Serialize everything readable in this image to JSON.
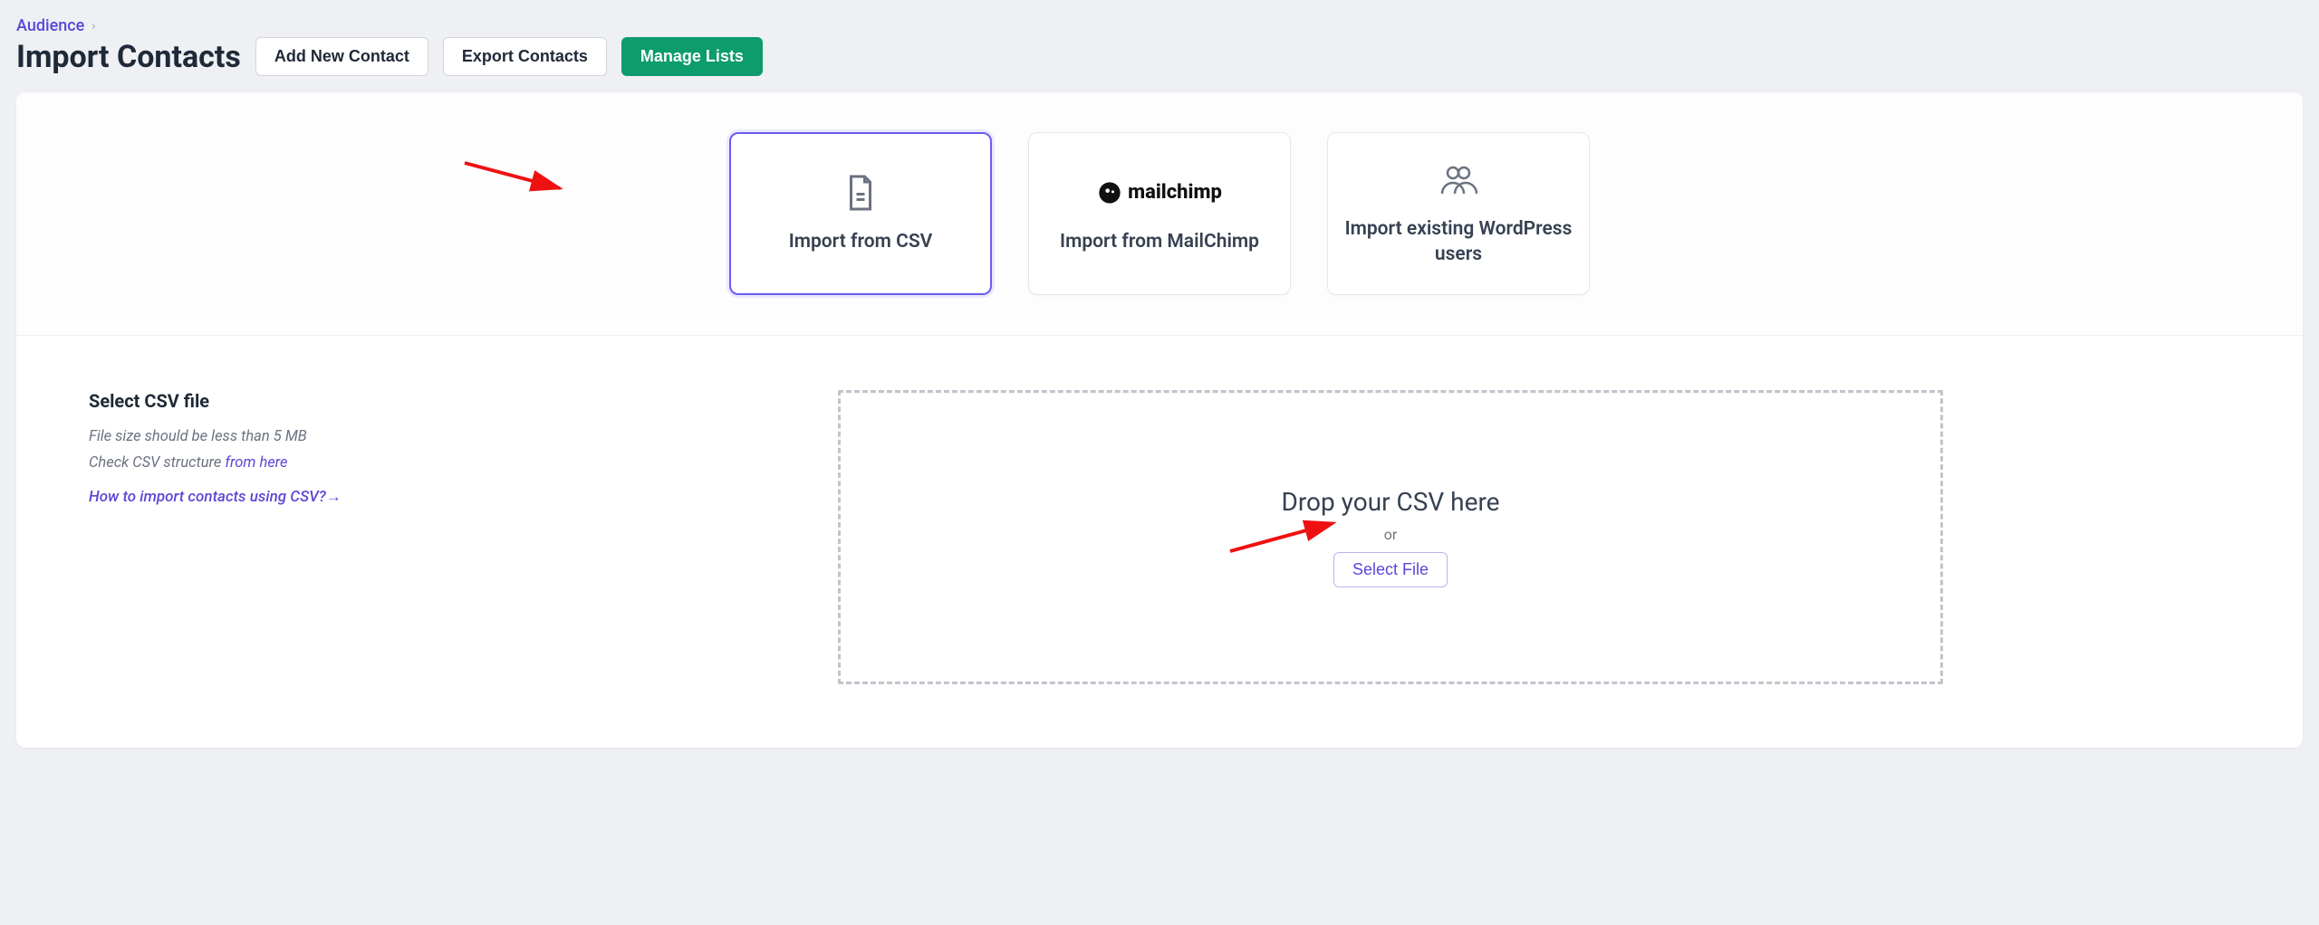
{
  "breadcrumb": {
    "parent": "Audience"
  },
  "page": {
    "title": "Import Contacts"
  },
  "actions": {
    "add_contact": "Add New Contact",
    "export": "Export Contacts",
    "manage_lists": "Manage Lists"
  },
  "options": {
    "csv": "Import from CSV",
    "mailchimp": "Import from MailChimp",
    "wp": "Import existing WordPress users"
  },
  "side": {
    "title": "Select CSV file",
    "hint1": "File size should be less than 5 MB",
    "hint2_prefix": "Check CSV structure ",
    "hint2_link": "from here",
    "help_link": "How to import contacts using CSV?→"
  },
  "dropzone": {
    "title": "Drop your CSV here",
    "or": "or",
    "select": "Select File"
  }
}
